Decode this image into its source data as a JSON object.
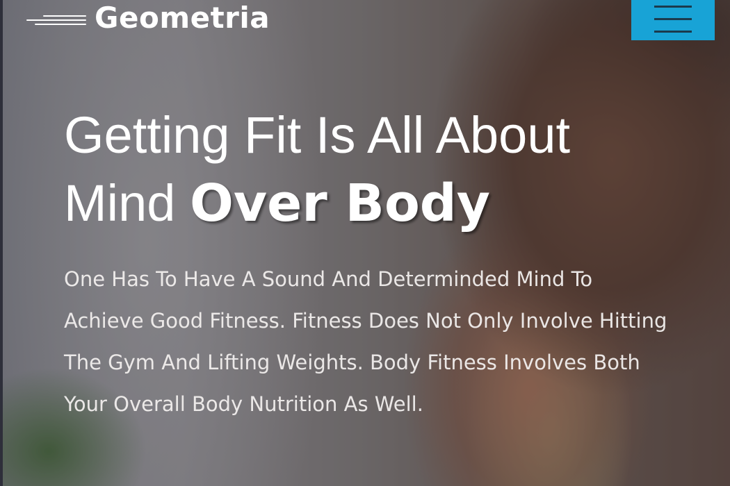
{
  "brand": {
    "name": "Geometria",
    "logo_icon": "stripes-logo-icon"
  },
  "header": {
    "menu_icon": "hamburger-menu-icon",
    "menu_button_color": "#18a3d6"
  },
  "hero": {
    "heading_line1": "Getting Fit Is All About",
    "heading_line2_regular": "Mind",
    "heading_line2_bold": "Over Body",
    "description": "One Has To Have A Sound And Determinded Mind To Achieve Good Fitness. Fitness Does Not Only Involve Hitting The Gym And Lifting Weights. Body Fitness Involves Both Your Overall Body Nutrition As Well."
  }
}
